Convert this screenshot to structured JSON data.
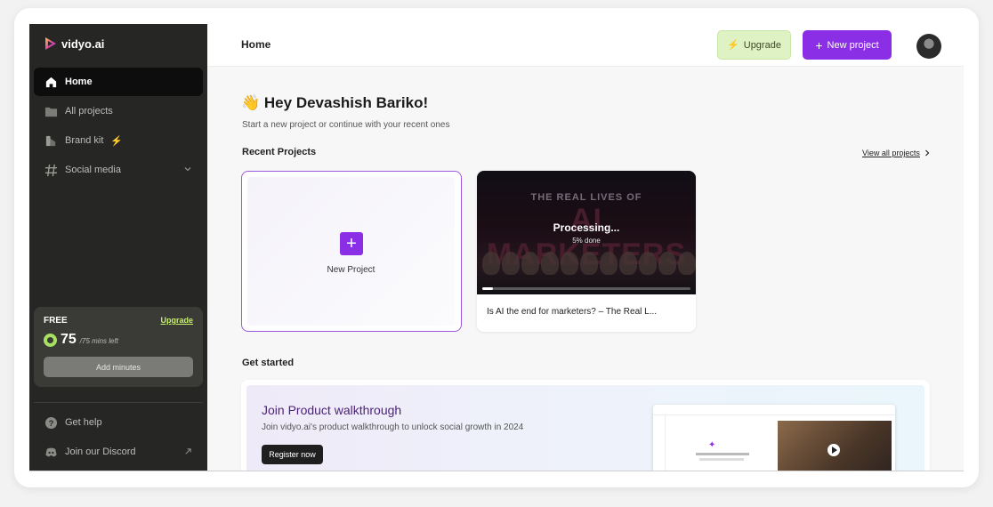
{
  "sidebar": {
    "logo_text": "vidyo.ai",
    "nav": [
      {
        "label": "Home",
        "icon": "home-icon",
        "active": true
      },
      {
        "label": "All projects",
        "icon": "folder-icon"
      },
      {
        "label": "Brand kit",
        "icon": "brand-kit-icon",
        "badge_icon": "bolt-icon"
      },
      {
        "label": "Social media",
        "icon": "hashtag-icon",
        "has_chevron": true
      }
    ],
    "plan": {
      "name": "FREE",
      "upgrade_label": "Upgrade",
      "minutes_left": "75",
      "minutes_text": "/75 mins left",
      "add_minutes_label": "Add minutes"
    },
    "footer": [
      {
        "label": "Get help",
        "icon": "help-icon"
      },
      {
        "label": "Join our Discord",
        "icon": "discord-icon",
        "trailing_icon": "external-link-icon"
      }
    ]
  },
  "topbar": {
    "breadcrumb": "Home",
    "upgrade_label": "Upgrade",
    "new_project_label": "New project"
  },
  "main": {
    "greeting": "Hey Devashish Bariko!",
    "greeting_emoji": "👋",
    "subtitle": "Start a new project or continue with your recent ones",
    "recent_title": "Recent Projects",
    "view_all_label": "View all projects",
    "new_project_card_label": "New Project",
    "projects": [
      {
        "title": "Is AI the end for marketers? – The Real L...",
        "thumb_line1": "THE REAL LIVES OF",
        "thumb_line2": "AI MARKETERS",
        "status": "Processing...",
        "progress_text": "5% done",
        "progress": 0.05
      }
    ],
    "get_started_title": "Get started",
    "walkthrough": {
      "title": "Join Product walkthrough",
      "description": "Join vidyo.ai's product walkthrough to unlock social growth in 2024",
      "button_label": "Register now"
    }
  },
  "colors": {
    "accent": "#8b2fe6",
    "sidebar_bg": "#262624",
    "upgrade_bg": "#dff2c4",
    "lime": "#a8e063"
  }
}
